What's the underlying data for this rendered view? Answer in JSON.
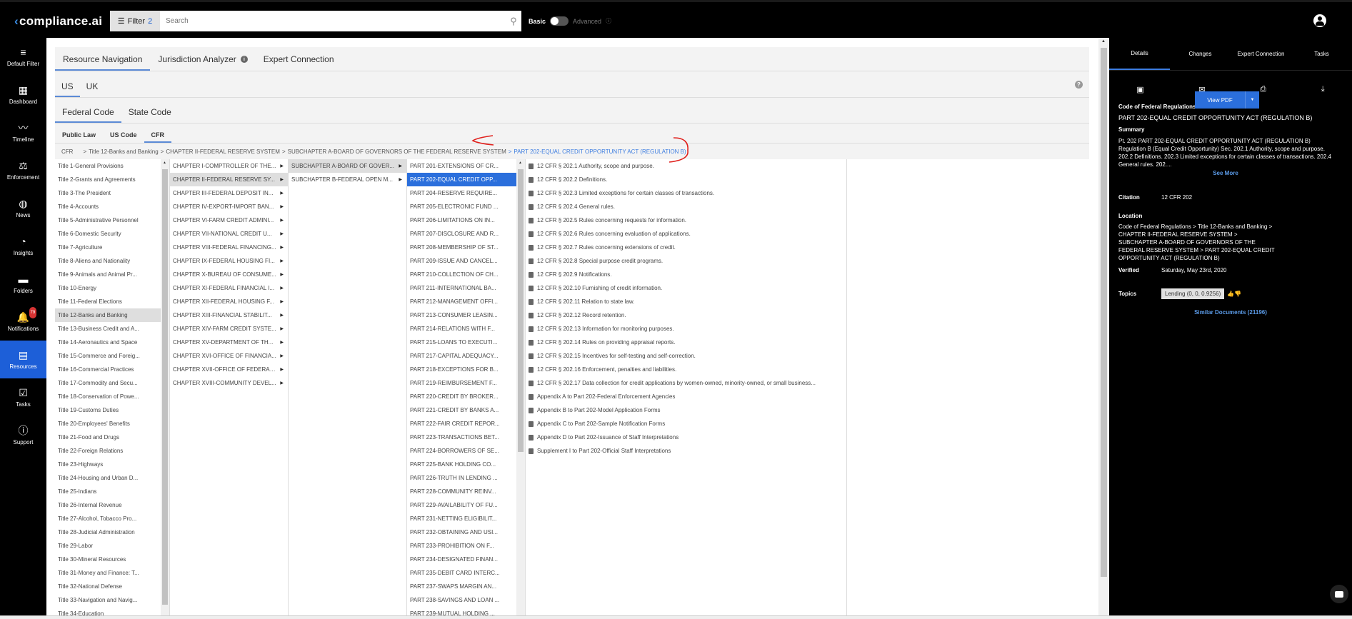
{
  "topbar": {
    "logo_text": "compliance.ai",
    "filter_label": "Filter",
    "filter_count": "2",
    "search_placeholder": "Search",
    "toggle_basic": "Basic",
    "toggle_advanced": "Advanced"
  },
  "leftnav": [
    {
      "label": "Default Filter",
      "icon": "filter-icon"
    },
    {
      "label": "Dashboard",
      "icon": "dashboard-icon"
    },
    {
      "label": "Timeline",
      "icon": "timeline-icon"
    },
    {
      "label": "Enforcement",
      "icon": "enforcement-icon"
    },
    {
      "label": "News",
      "icon": "globe-icon"
    },
    {
      "label": "Insights",
      "icon": "pie-chart-icon"
    },
    {
      "label": "Folders",
      "icon": "folder-icon"
    },
    {
      "label": "Notifications",
      "icon": "bell-icon",
      "badge": "79"
    },
    {
      "label": "Resources",
      "icon": "resources-icon",
      "active": true
    },
    {
      "label": "Tasks",
      "icon": "checkbox-icon"
    },
    {
      "label": "Support",
      "icon": "info-icon"
    }
  ],
  "tabs": {
    "main": [
      "Resource Navigation",
      "Jurisdiction Analyzer",
      "Expert Connection"
    ],
    "country": [
      "US",
      "UK"
    ],
    "code": [
      "Federal Code",
      "State Code"
    ],
    "source": [
      "Public Law",
      "US Code",
      "CFR"
    ]
  },
  "breadcrumb": {
    "root": "CFR",
    "title": "Title 12-Banks and Banking",
    "chapter": "CHAPTER II-FEDERAL RESERVE SYSTEM",
    "subchapter": "SUBCHAPTER A-BOARD OF GOVERNORS OF THE FEDERAL RESERVE SYSTEM",
    "current": "PART 202-EQUAL CREDIT OPPORTUNITY ACT (REGULATION B)"
  },
  "titles": [
    "Title 1-General Provisions",
    "Title 2-Grants and Agreements",
    "Title 3-The President",
    "Title 4-Accounts",
    "Title 5-Administrative Personnel",
    "Title 6-Domestic Security",
    "Title 7-Agriculture",
    "Title 8-Aliens and Nationality",
    "Title 9-Animals and Animal Pr...",
    "Title 10-Energy",
    "Title 11-Federal Elections",
    "Title 12-Banks and Banking",
    "Title 13-Business Credit and A...",
    "Title 14-Aeronautics and Space",
    "Title 15-Commerce and Foreig...",
    "Title 16-Commercial Practices",
    "Title 17-Commodity and Secu...",
    "Title 18-Conservation of Powe...",
    "Title 19-Customs Duties",
    "Title 20-Employees' Benefits",
    "Title 21-Food and Drugs",
    "Title 22-Foreign Relations",
    "Title 23-Highways",
    "Title 24-Housing and Urban D...",
    "Title 25-Indians",
    "Title 26-Internal Revenue",
    "Title 27-Alcohol, Tobacco Pro...",
    "Title 28-Judicial Administration",
    "Title 29-Labor",
    "Title 30-Mineral Resources",
    "Title 31-Money and Finance: T...",
    "Title 32-National Defense",
    "Title 33-Navigation and Navig...",
    "Title 34-Education"
  ],
  "chapters": [
    "CHAPTER I-COMPTROLLER OF THE...",
    "CHAPTER II-FEDERAL RESERVE SY...",
    "CHAPTER III-FEDERAL DEPOSIT IN...",
    "CHAPTER IV-EXPORT-IMPORT BAN...",
    "CHAPTER VI-FARM CREDIT ADMINI...",
    "CHAPTER VII-NATIONAL CREDIT U...",
    "CHAPTER VIII-FEDERAL FINANCING...",
    "CHAPTER IX-FEDERAL HOUSING FI...",
    "CHAPTER X-BUREAU OF CONSUME...",
    "CHAPTER XI-FEDERAL FINANCIAL I...",
    "CHAPTER XII-FEDERAL HOUSING F...",
    "CHAPTER XIII-FINANCIAL STABILIT...",
    "CHAPTER XIV-FARM CREDIT SYSTE...",
    "CHAPTER XV-DEPARTMENT OF TH...",
    "CHAPTER XVI-OFFICE OF FINANCIA...",
    "CHAPTER XVII-OFFICE OF FEDERAL...",
    "CHAPTER XVIII-COMMUNITY DEVEL..."
  ],
  "subchapters": [
    "SUBCHAPTER A-BOARD OF GOVER...",
    "SUBCHAPTER B-FEDERAL OPEN M..."
  ],
  "parts": [
    "PART 201-EXTENSIONS OF CR...",
    "PART 202-EQUAL CREDIT OPP...",
    "PART 204-RESERVE REQUIRE...",
    "PART 205-ELECTRONIC FUND ...",
    "PART 206-LIMITATIONS ON IN...",
    "PART 207-DISCLOSURE AND R...",
    "PART 208-MEMBERSHIP OF ST...",
    "PART 209-ISSUE AND CANCEL...",
    "PART 210-COLLECTION OF CH...",
    "PART 211-INTERNATIONAL BA...",
    "PART 212-MANAGEMENT OFFI...",
    "PART 213-CONSUMER LEASIN...",
    "PART 214-RELATIONS WITH F...",
    "PART 215-LOANS TO EXECUTI...",
    "PART 217-CAPITAL ADEQUACY...",
    "PART 218-EXCEPTIONS FOR B...",
    "PART 219-REIMBURSEMENT F...",
    "PART 220-CREDIT BY BROKER...",
    "PART 221-CREDIT BY BANKS A...",
    "PART 222-FAIR CREDIT REPOR...",
    "PART 223-TRANSACTIONS BET...",
    "PART 224-BORROWERS OF SE...",
    "PART 225-BANK HOLDING CO...",
    "PART 226-TRUTH IN LENDING ...",
    "PART 228-COMMUNITY REINV...",
    "PART 229-AVAILABILITY OF FU...",
    "PART 231-NETTING ELIGIBILIT...",
    "PART 232-OBTAINING AND USI...",
    "PART 233-PROHIBITION ON F...",
    "PART 234-DESIGNATED FINAN...",
    "PART 235-DEBIT CARD INTERC...",
    "PART 237-SWAPS MARGIN AN...",
    "PART 238-SAVINGS AND LOAN ...",
    "PART 239-MUTUAL HOLDING ..."
  ],
  "sections": [
    "12 CFR § 202.1 Authority, scope and purpose.",
    "12 CFR § 202.2 Definitions.",
    "12 CFR § 202.3 Limited exceptions for certain classes of transactions.",
    "12 CFR § 202.4 General rules.",
    "12 CFR § 202.5 Rules concerning requests for information.",
    "12 CFR § 202.6 Rules concerning evaluation of applications.",
    "12 CFR § 202.7 Rules concerning extensions of credit.",
    "12 CFR § 202.8 Special purpose credit programs.",
    "12 CFR § 202.9 Notifications.",
    "12 CFR § 202.10 Furnishing of credit information.",
    "12 CFR § 202.11 Relation to state law.",
    "12 CFR § 202.12 Record retention.",
    "12 CFR § 202.13 Information for monitoring purposes.",
    "12 CFR § 202.14 Rules on providing appraisal reports.",
    "12 CFR § 202.15 Incentives for self-testing and self-correction.",
    "12 CFR § 202.16 Enforcement, penalties and liabilities.",
    "12 CFR § 202.17 Data collection for credit applications by women-owned, minority-owned, or small business...",
    "Appendix A to Part 202-Federal Enforcement Agencies",
    "Appendix B to Part 202-Model Application Forms",
    "Appendix C to Part 202-Sample Notification Forms",
    "Appendix D to Part 202-Issuance of Staff Interpretations",
    "Supplement I to Part 202-Official Staff Interpretations"
  ],
  "details": {
    "tabs": [
      "Details",
      "Changes",
      "Expert Connection",
      "Tasks"
    ],
    "doc_type_label": "Code of Federal Regulations",
    "doc_title": "PART 202-EQUAL CREDIT OPPORTUNITY ACT (REGULATION B)",
    "view_pdf": "View PDF",
    "summary_label": "Summary",
    "summary_text": "Pt. 202 PART 202-EQUAL CREDIT OPPORTUNITY ACT (REGULATION B) Regulation B (Equal Credit Opportunity) Sec. 202.1 Authority, scope and purpose. 202.2 Definitions. 202.3 Limited exceptions for certain classes of transactions. 202.4 General rules. 202....",
    "see_more": "See More",
    "citation_label": "Citation",
    "citation_value": "12 CFR 202",
    "location_label": "Location",
    "location_value": "Code of Federal Regulations > Title 12-Banks and Banking > CHAPTER II-FEDERAL RESERVE SYSTEM > SUBCHAPTER A-BOARD OF GOVERNORS OF THE FEDERAL RESERVE SYSTEM > PART 202-EQUAL CREDIT OPPORTUNITY ACT (REGULATION B)",
    "verified_label": "Verified",
    "verified_value": "Saturday, May 23rd, 2020",
    "topics_label": "Topics",
    "topic_chip": "Lending (0, 0, 0.9256)",
    "similar": "Similar Documents (21196)"
  },
  "colors": {
    "accent": "#2b6fdc",
    "link": "#3d7de0",
    "annotation": "#e0201c"
  }
}
